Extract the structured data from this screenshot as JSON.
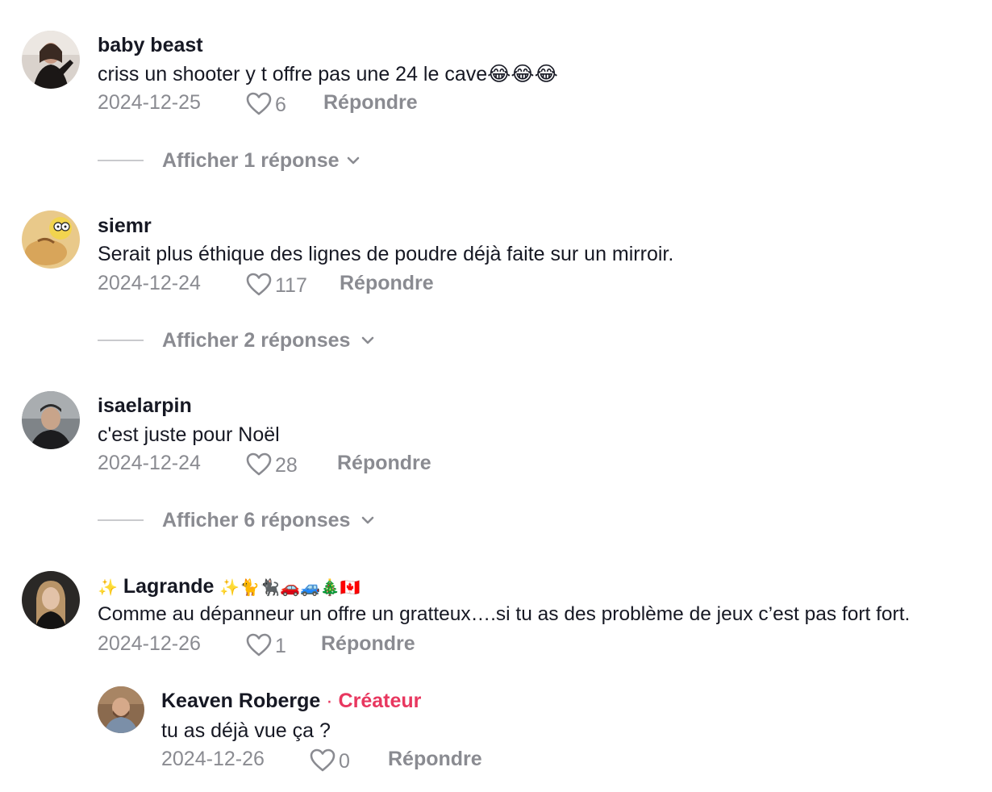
{
  "comments": [
    {
      "username": "baby beast",
      "text": "criss un shooter y t offre pas une 24 le cave😂😂😂",
      "date": "2024-12-25",
      "likes": "6",
      "reply_label": "Répondre",
      "view_replies": "Afficher 1 réponse"
    },
    {
      "username": "siemr",
      "text": "Serait plus éthique des lignes de poudre déjà faite sur un mirroir.",
      "date": "2024-12-24",
      "likes": "117",
      "reply_label": "Répondre",
      "view_replies": "Afficher 2 réponses"
    },
    {
      "username": "isaelarpin",
      "text": "c'est juste pour Noël",
      "date": "2024-12-24",
      "likes": "28",
      "reply_label": "Répondre",
      "view_replies": "Afficher 6 réponses"
    },
    {
      "username_prefix": "✨",
      "username": "Lagrande",
      "username_suffix": "✨🐈🐈‍⬛🚗🚙🎄🇨🇦",
      "text": "Comme au dépanneur un offre un gratteux….si tu as des problème de jeux c’est pas fort fort.",
      "date": "2024-12-26",
      "likes": "1",
      "reply_label": "Répondre"
    }
  ],
  "reply": {
    "username": "Keaven Roberge",
    "separator": "·",
    "badge": "Créateur",
    "text": "tu as déjà vue ça ?",
    "date": "2024-12-26",
    "likes": "0",
    "reply_label": "Répondre"
  },
  "colors": {
    "primary_text": "#161823",
    "secondary_text": "#8a8b91",
    "creator_accent": "#e8375f"
  },
  "icons": {
    "like": "heart-outline-icon",
    "expand": "chevron-down-icon"
  }
}
